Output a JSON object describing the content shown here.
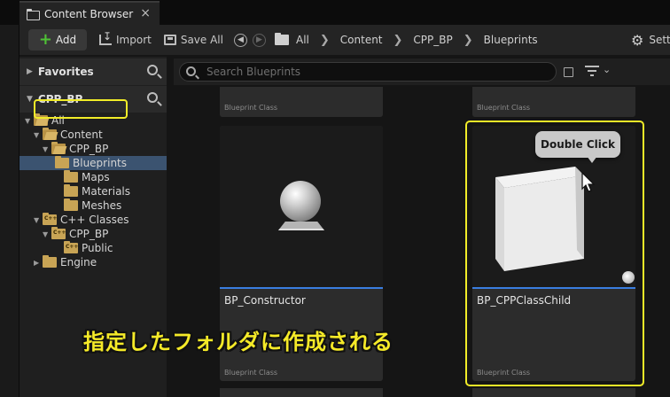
{
  "window": {
    "tab_title": "Content Browser",
    "tab_close": "×"
  },
  "toolbar": {
    "add_label": "Add",
    "import_label": "Import",
    "save_all_label": "Save All",
    "breadcrumb": [
      "All",
      "Content",
      "CPP_BP",
      "Blueprints"
    ],
    "settings_label": "Settings"
  },
  "sidebar": {
    "favorites_label": "Favorites",
    "project_label": "CPP_BP",
    "tree": [
      {
        "label": "All"
      },
      {
        "label": "Content"
      },
      {
        "label": "CPP_BP"
      },
      {
        "label": "Blueprints",
        "selected": true
      },
      {
        "label": "Maps"
      },
      {
        "label": "Materials"
      },
      {
        "label": "Meshes"
      },
      {
        "label": "C++ Classes"
      },
      {
        "label": "CPP_BP"
      },
      {
        "label": "Public"
      },
      {
        "label": "Engine"
      }
    ]
  },
  "search": {
    "placeholder": "Search Blueprints"
  },
  "assets": {
    "top_left_class": "Blueprint Class",
    "top_right_class": "Blueprint Class",
    "items": [
      {
        "name": "BP_Constructor",
        "class": "Blueprint Class",
        "icon": "sphere-icon"
      },
      {
        "name": "BP_CPPClassChild",
        "class": "Blueprint Class",
        "icon": "cube-icon"
      }
    ]
  },
  "annotation": {
    "tooltip": "Double Click",
    "caption": "指定したフォルダに作成される"
  },
  "colors": {
    "highlight": "#f1ec28",
    "selection": "#3b5370",
    "accent_bar": "#3a7ee0",
    "folder": "#c8a455",
    "add_plus": "#4fc236"
  }
}
